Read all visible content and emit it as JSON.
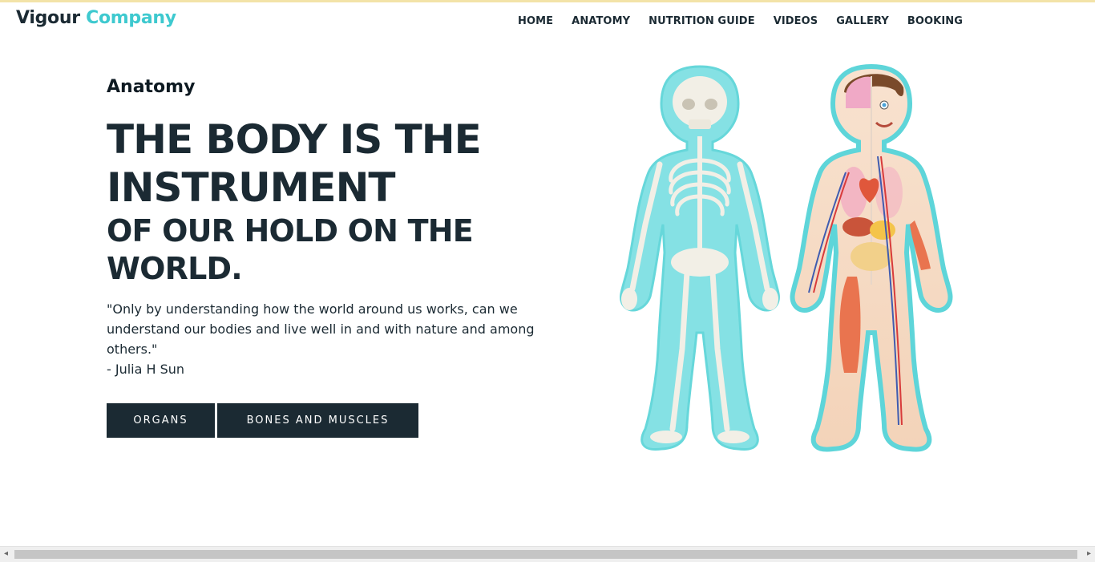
{
  "brand": {
    "part1": "Vigour",
    "part2": "Company"
  },
  "nav": {
    "items": [
      {
        "label": "HOME"
      },
      {
        "label": "ANATOMY"
      },
      {
        "label": "NUTRITION GUIDE"
      },
      {
        "label": "VIDEOS"
      },
      {
        "label": "GALLERY"
      },
      {
        "label": "BOOKING"
      }
    ]
  },
  "hero": {
    "subtitle": "Anatomy",
    "title_line1": "THE BODY IS THE",
    "title_line2": "INSTRUMENT",
    "title_line3": "OF OUR HOLD ON THE",
    "title_line4": "WORLD.",
    "quote": "\"Only by understanding how the world around us works, can we understand our bodies and live well in and with nature and among others.\"",
    "author": "- Julia H Sun",
    "buttons": {
      "organs": "ORGANS",
      "bones": "BONES AND MUSCLES"
    }
  },
  "illustration": {
    "icon": "human-anatomy-illustration"
  },
  "scrollbar": {
    "left_arrow": "◂",
    "right_arrow": "▸"
  },
  "colors": {
    "accent": "#3ec9cf",
    "dark": "#1b2a33",
    "top_line": "#f3e3a8"
  }
}
